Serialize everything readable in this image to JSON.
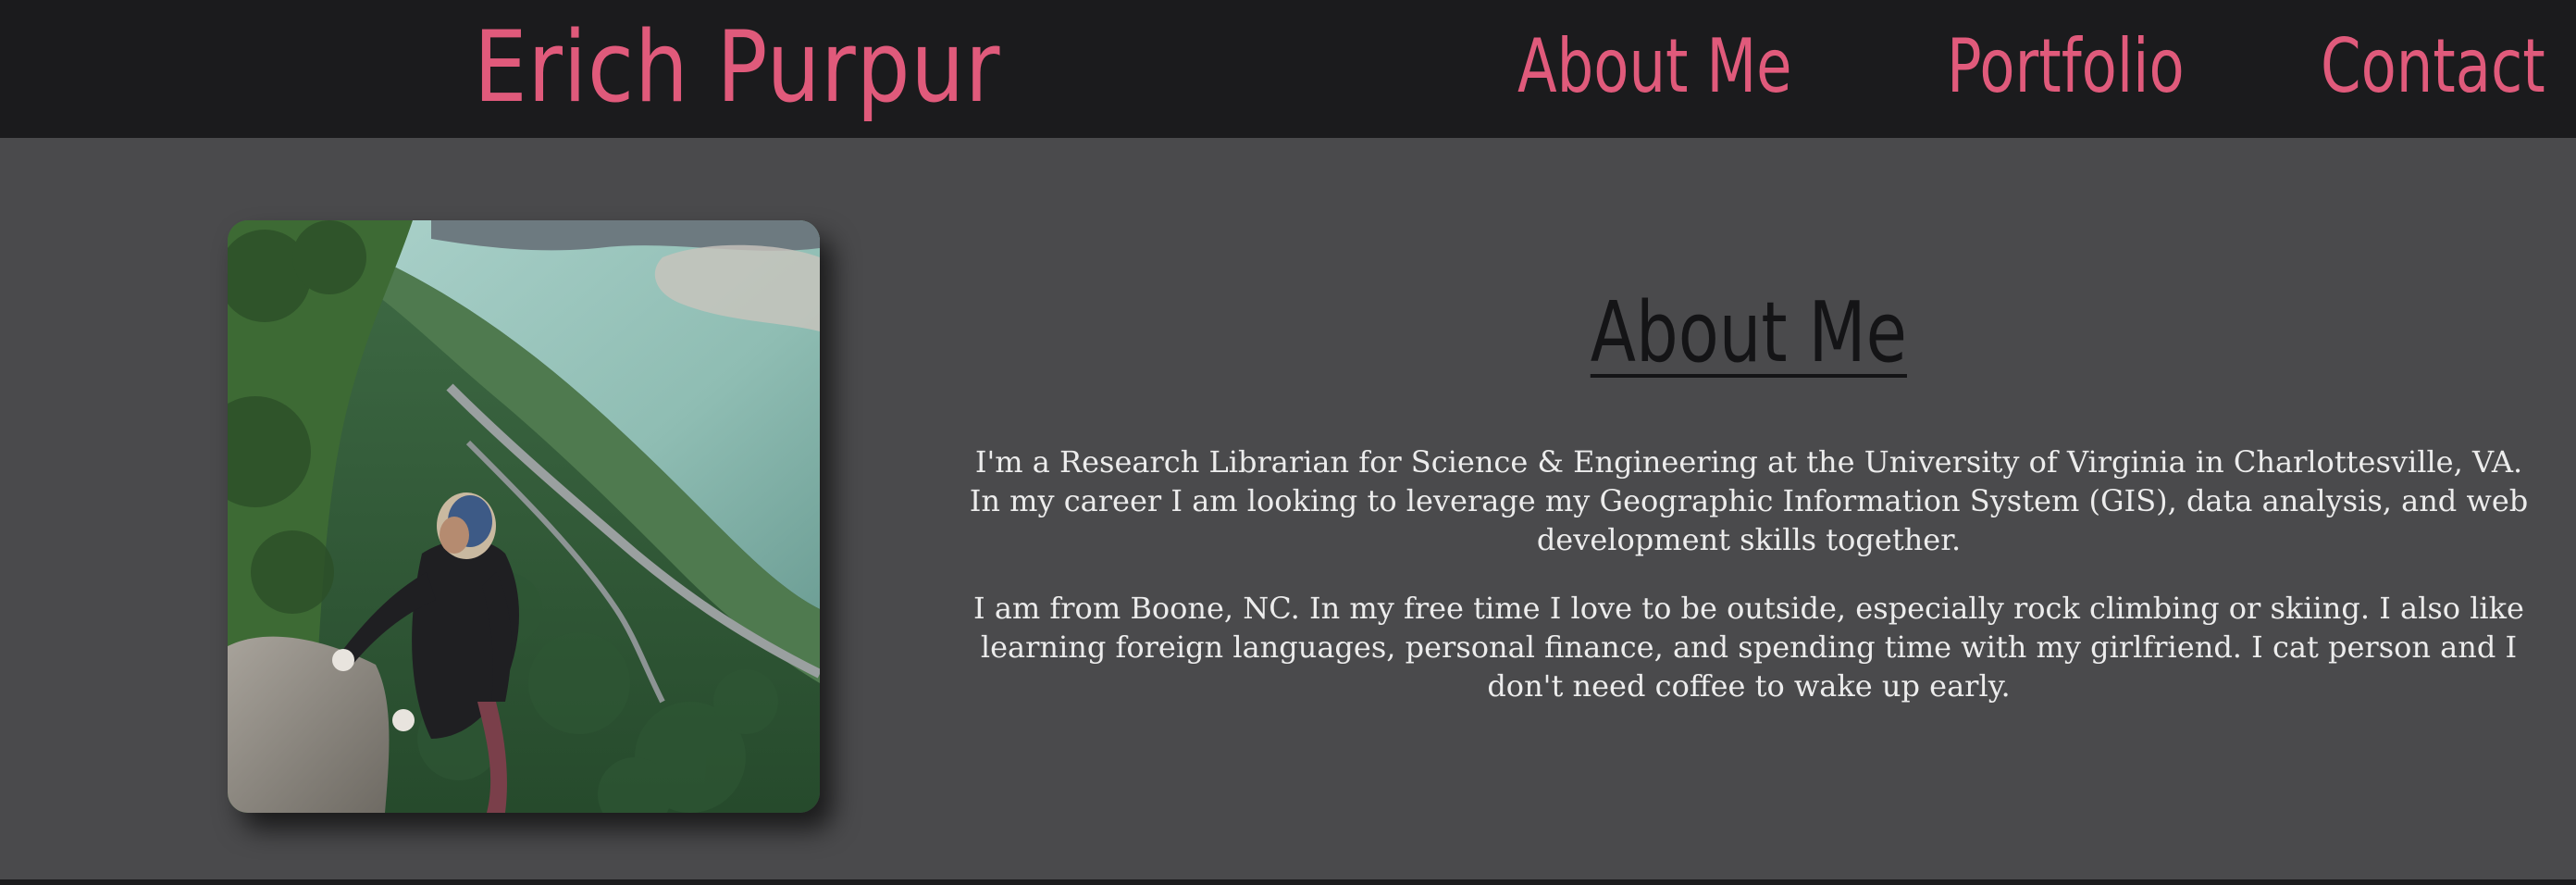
{
  "brand": {
    "name": "Erich Purpur"
  },
  "nav": {
    "items": [
      {
        "label": "About Me"
      },
      {
        "label": "Portfolio"
      },
      {
        "label": "Contact"
      }
    ]
  },
  "about": {
    "heading": "About Me",
    "paragraphs": [
      "I'm a Research Librarian for Science & Engineering at the University of Virginia in Charlottesville, VA. In my career I am looking to leverage my Geographic Information System (GIS), data analysis, and web development skills together.",
      "I am from Boone, NC. In my free time I love to be outside, especially rock climbing or skiing. I also like learning foreign languages, personal finance, and spending time with my girlfriend. I cat person and I don't need coffee to wake up early."
    ]
  },
  "colors": {
    "accent": "#e05a7b",
    "navbar_bg": "#1b1b1d",
    "page_bg": "#4a4a4c",
    "body_text": "#ececec",
    "heading_text": "#141416"
  }
}
